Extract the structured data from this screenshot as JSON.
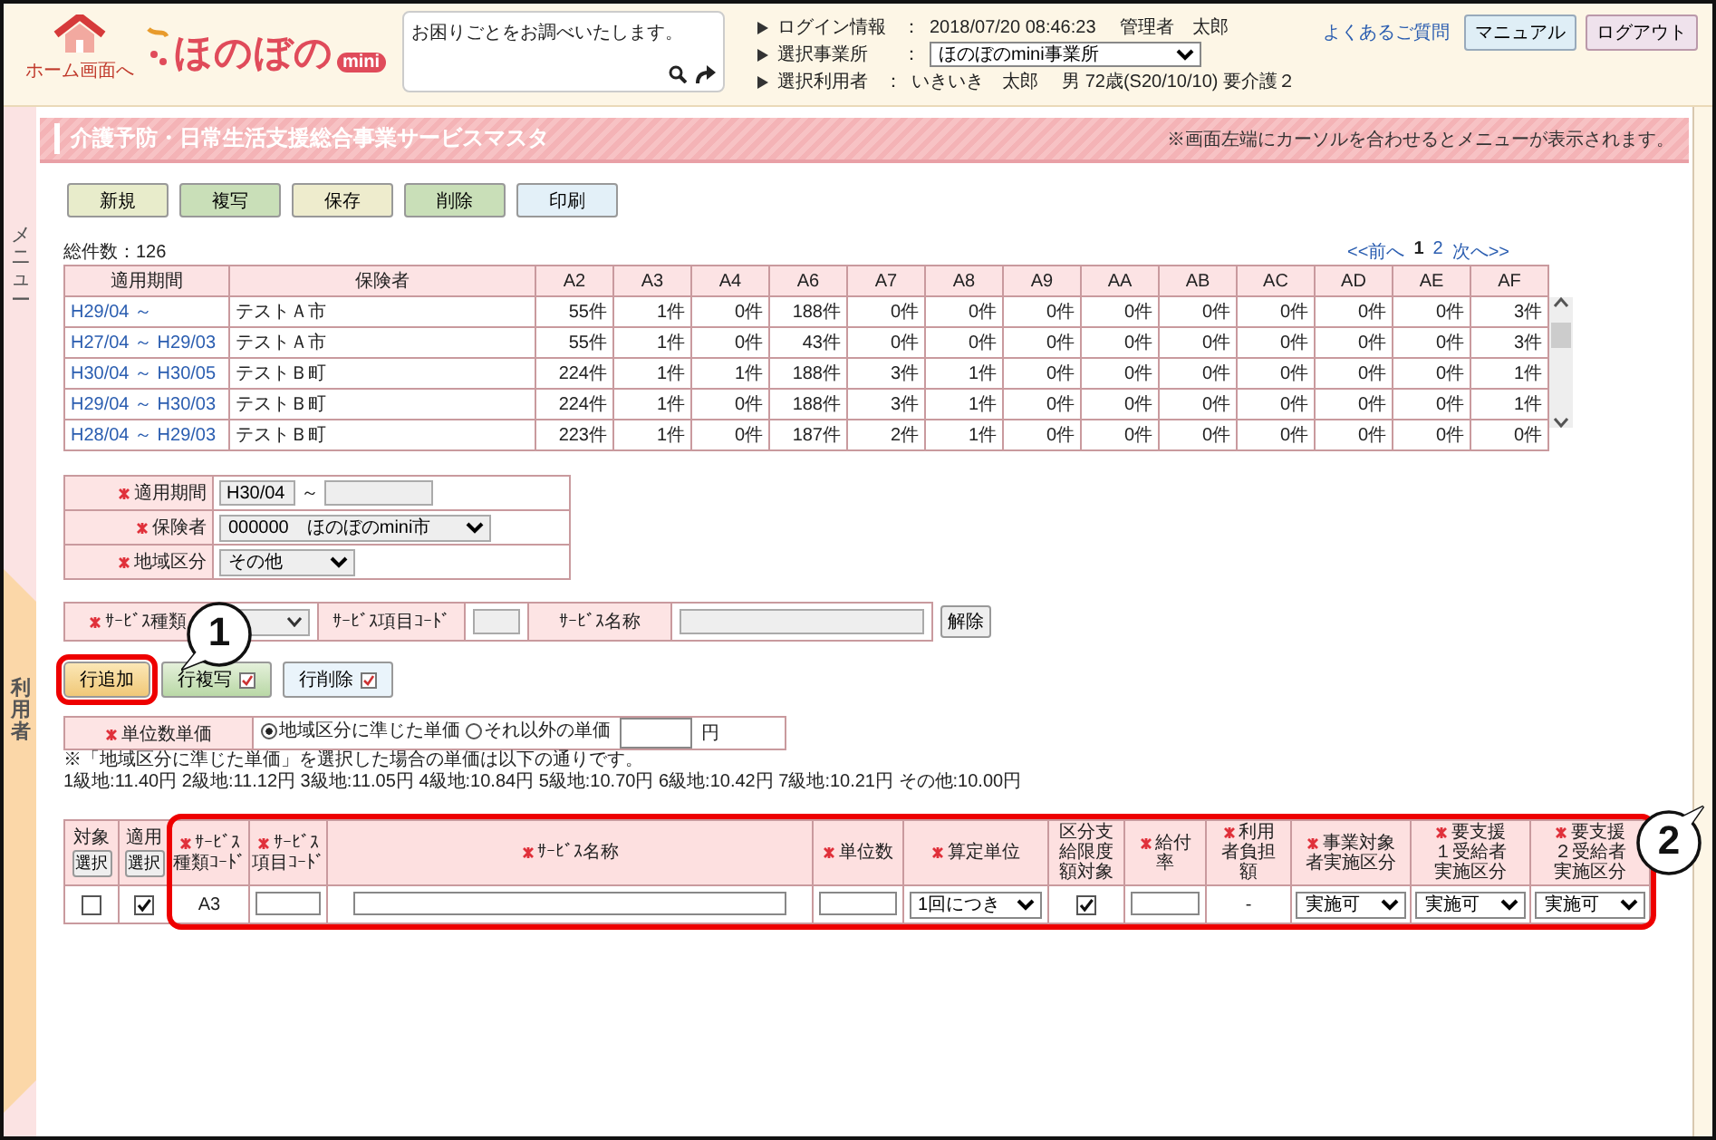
{
  "header": {
    "home_label": "ホーム画面へ",
    "logo": {
      "text": "ほのぼの",
      "badge": "mini"
    },
    "search": {
      "placeholder": "お困りごとをお調べいたします。"
    },
    "info": [
      {
        "label": "ログイン情報",
        "sep": "：",
        "kind": "text",
        "values": [
          "2018/07/20 08:46:23",
          "管理者　太郎"
        ]
      },
      {
        "label": "選択事業所",
        "sep": "：",
        "kind": "select",
        "values": [
          "ほのぼのmini事業所"
        ]
      },
      {
        "label": "選択利用者",
        "sep": "：",
        "kind": "text",
        "values": [
          "いきいき　太郎",
          "男 72歳(S20/10/10) 要介護２"
        ]
      }
    ],
    "help_link": "よくあるご質問",
    "buttons": [
      {
        "label": "マニュアル"
      },
      {
        "label": "ログアウト"
      }
    ]
  },
  "sidebar": {
    "menu_label": "メニュー",
    "user_label": "利用者"
  },
  "title": "介護予防・日常生活支援総合事業サービスマスタ",
  "title_note": "※画面左端にカーソルを合わせるとメニューが表示されます。",
  "toolbar": [
    {
      "label": "新規",
      "color": "#e8eccb"
    },
    {
      "label": "複写",
      "color": "#c9dfb8"
    },
    {
      "label": "保存",
      "color": "#eeeccd"
    },
    {
      "label": "削除",
      "color": "#c9dfb8"
    },
    {
      "label": "印刷",
      "color": "#e3f0f8"
    }
  ],
  "total": "総件数：126",
  "pagination": {
    "prev": "<<前へ",
    "pages": [
      {
        "label": "1",
        "selected": true
      },
      {
        "label": "2",
        "selected": false
      }
    ],
    "next": "次へ>>"
  },
  "table": {
    "columns": [
      "適用期間",
      "保険者",
      "A2",
      "A3",
      "A4",
      "A6",
      "A7",
      "A8",
      "A9",
      "AA",
      "AB",
      "AC",
      "AD",
      "AE",
      "AF"
    ],
    "rows": [
      {
        "cells": [
          "H29/04 ～",
          "テストＡ市",
          "55件",
          "1件",
          "0件",
          "188件",
          "0件",
          "0件",
          "0件",
          "0件",
          "0件",
          "0件",
          "0件",
          "0件",
          "3件"
        ]
      },
      {
        "cells": [
          "H27/04 ～ H29/03",
          "テストＡ市",
          "55件",
          "1件",
          "0件",
          "43件",
          "0件",
          "0件",
          "0件",
          "0件",
          "0件",
          "0件",
          "0件",
          "0件",
          "3件"
        ]
      },
      {
        "cells": [
          "H30/04 ～ H30/05",
          "テストＢ町",
          "224件",
          "1件",
          "1件",
          "188件",
          "3件",
          "1件",
          "0件",
          "0件",
          "0件",
          "0件",
          "0件",
          "0件",
          "1件"
        ]
      },
      {
        "cells": [
          "H29/04 ～ H30/03",
          "テストＢ町",
          "224件",
          "1件",
          "0件",
          "188件",
          "3件",
          "1件",
          "0件",
          "0件",
          "0件",
          "0件",
          "0件",
          "0件",
          "1件"
        ]
      },
      {
        "cells": [
          "H28/04 ～ H29/03",
          "テストＢ町",
          "223件",
          "1件",
          "0件",
          "187件",
          "2件",
          "1件",
          "0件",
          "0件",
          "0件",
          "0件",
          "0件",
          "0件",
          "0件"
        ]
      }
    ]
  },
  "filters": [
    {
      "label": "適用期間",
      "required": true,
      "kind": "range",
      "value": "H30/04",
      "sep": "～"
    },
    {
      "label": "保険者",
      "required": true,
      "kind": "select",
      "value": "000000　ほのぼのmini市"
    },
    {
      "label": "地域区分",
      "required": true,
      "kind": "select",
      "value": "その他"
    }
  ],
  "search_row": {
    "fields": [
      {
        "label": "ｻｰﾋﾞｽ種類",
        "required": true,
        "kind": "select"
      },
      {
        "label": "ｻｰﾋﾞｽ項目ｺｰﾄﾞ",
        "required": false,
        "kind": "input"
      },
      {
        "label": "ｻｰﾋﾞｽ名称",
        "required": false,
        "kind": "input"
      }
    ],
    "clear_button": "解除"
  },
  "row_buttons": [
    {
      "label": "行追加",
      "kind": "add",
      "highlighted": true
    },
    {
      "label": "行複写",
      "kind": "copy",
      "highlighted": false
    },
    {
      "label": "行削除",
      "kind": "delete",
      "highlighted": false
    }
  ],
  "unit_price": {
    "label": "単位数単価",
    "required": true,
    "options": [
      {
        "label": "地域区分に準じた単価",
        "selected": true
      },
      {
        "label": "それ以外の単価",
        "selected": false
      }
    ],
    "unit": "円"
  },
  "notes": [
    "※「地域区分に準じた単価」を選択した場合の単価は以下の通りです。",
    "1級地:11.40円 2級地:11.12円 3級地:11.05円 4級地:10.84円 5級地:10.70円 6級地:10.42円 7級地:10.21円 その他:10.00円"
  ],
  "grid": {
    "highlighted": true,
    "columns": [
      {
        "label": "対象",
        "required": false,
        "button": "選択"
      },
      {
        "label": "適用",
        "required": false,
        "button": "選択"
      },
      {
        "label": "ｻｰﾋﾞｽ種類ｺｰﾄﾞ",
        "required": true
      },
      {
        "label": "ｻｰﾋﾞｽ項目ｺｰﾄﾞ",
        "required": true
      },
      {
        "label": "ｻｰﾋﾞｽ名称",
        "required": true
      },
      {
        "label": "単位数",
        "required": true
      },
      {
        "label": "算定単位",
        "required": true
      },
      {
        "label": "区分支給限度額対象",
        "required": false
      },
      {
        "label": "給付率",
        "required": true
      },
      {
        "label": "利用者負担額",
        "required": true
      },
      {
        "label": "事業対象者実施区分",
        "required": true
      },
      {
        "label": "要支援１受給者実施区分",
        "required": true
      },
      {
        "label": "要支援２受給者実施区分",
        "required": true
      }
    ],
    "rows": [
      {
        "cells": [
          {
            "kind": "checkbox",
            "checked": false
          },
          {
            "kind": "checkbox",
            "checked": true
          },
          {
            "kind": "text",
            "value": "A3"
          },
          {
            "kind": "input"
          },
          {
            "kind": "input"
          },
          {
            "kind": "input"
          },
          {
            "kind": "select",
            "value": "1回につき"
          },
          {
            "kind": "checkbox",
            "checked": true
          },
          {
            "kind": "input"
          },
          {
            "kind": "text",
            "value": "-"
          },
          {
            "kind": "select",
            "value": "実施可"
          },
          {
            "kind": "select",
            "value": "実施可"
          },
          {
            "kind": "select",
            "value": "実施可"
          }
        ]
      }
    ]
  },
  "annotations": [
    {
      "label": "1"
    },
    {
      "label": "2"
    }
  ]
}
